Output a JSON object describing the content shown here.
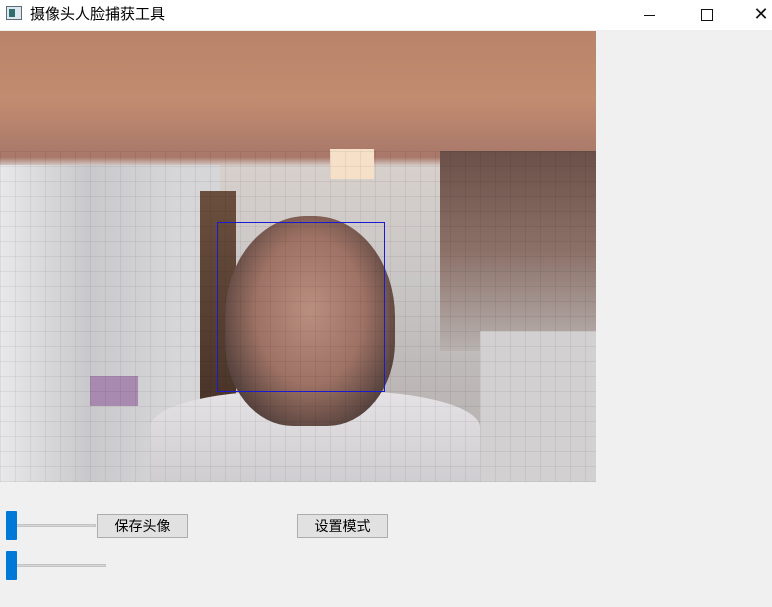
{
  "window": {
    "title": "摄像头人脸捕获工具",
    "icon": "app-window-icon",
    "controls": [
      "minimize-icon",
      "maximize-icon",
      "close-icon"
    ]
  },
  "camera_view": {
    "content": "live-camera-feed",
    "face_detection_box_color": "#1a1ad0"
  },
  "controls": {
    "slider_top": {
      "value": 0
    },
    "slider_bottom": {
      "value": 0
    },
    "save_button_label": "保存头像",
    "mode_button_label": "设置模式",
    "accent_color": "#0078d7"
  }
}
